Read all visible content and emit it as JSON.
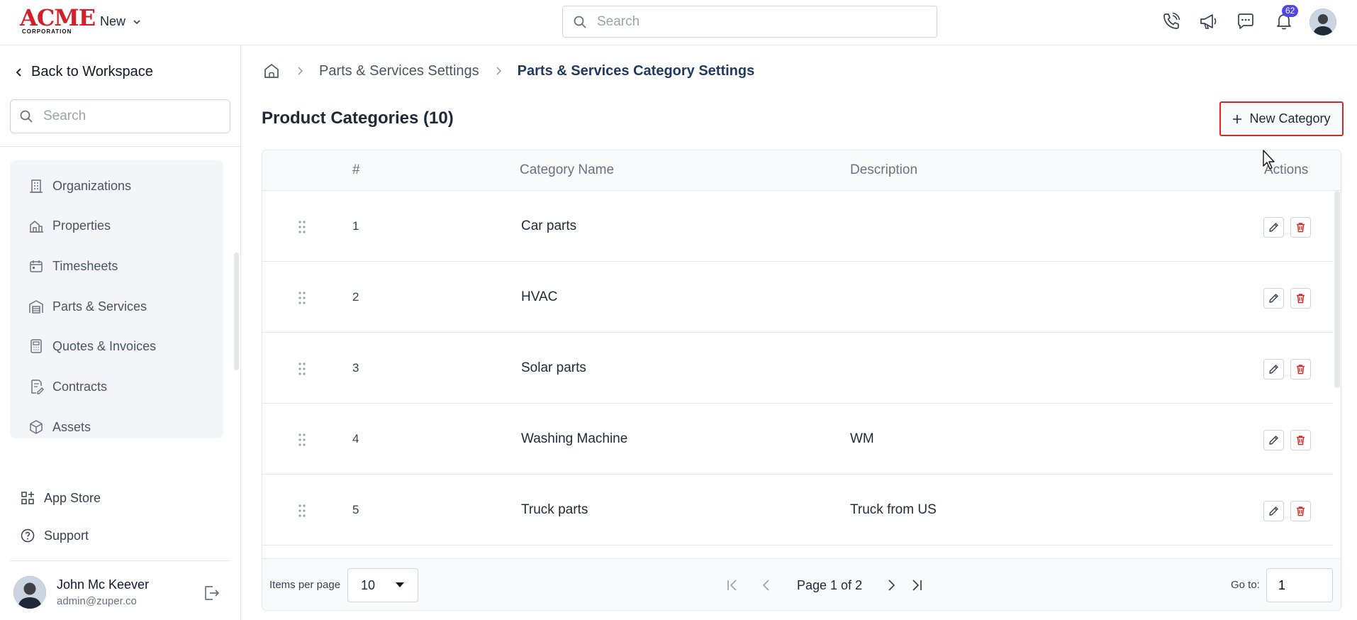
{
  "header": {
    "logo_main": "ACME",
    "logo_sub": "CORPORATION",
    "new_label": "New",
    "search_placeholder": "Search",
    "notification_count": "62"
  },
  "sidebar": {
    "back_label": "Back to Workspace",
    "search_placeholder": "Search",
    "items": [
      {
        "label": "Organizations",
        "icon": "building-icon"
      },
      {
        "label": "Properties",
        "icon": "properties-icon"
      },
      {
        "label": "Timesheets",
        "icon": "calendar-icon"
      },
      {
        "label": "Parts & Services",
        "icon": "warehouse-icon"
      },
      {
        "label": "Quotes & Invoices",
        "icon": "calculator-icon"
      },
      {
        "label": "Contracts",
        "icon": "contract-icon"
      },
      {
        "label": "Assets",
        "icon": "cube-icon"
      }
    ],
    "bottom_items": [
      {
        "label": "App Store",
        "icon": "app-store-icon"
      },
      {
        "label": "Support",
        "icon": "help-icon"
      }
    ],
    "user": {
      "name": "John Mc Keever",
      "email": "admin@zuper.co"
    }
  },
  "breadcrumb": {
    "items": [
      "Parts & Services Settings",
      "Parts & Services Category Settings"
    ]
  },
  "page": {
    "title": "Product Categories (10)",
    "new_button_label": "New Category"
  },
  "table": {
    "columns": [
      "#",
      "Category Name",
      "Description",
      "Actions"
    ],
    "rows": [
      {
        "num": "1",
        "name": "Car parts",
        "description": ""
      },
      {
        "num": "2",
        "name": "HVAC",
        "description": ""
      },
      {
        "num": "3",
        "name": "Solar parts",
        "description": ""
      },
      {
        "num": "4",
        "name": "Washing Machine",
        "description": "WM"
      },
      {
        "num": "5",
        "name": "Truck parts",
        "description": "Truck from US"
      }
    ]
  },
  "pagination": {
    "items_per_page_label": "Items per page",
    "items_per_page_value": "10",
    "page_text": "Page 1 of 2",
    "goto_label": "Go to:",
    "goto_value": "1"
  },
  "colors": {
    "accent_red": "#dc2626",
    "badge": "#4f46e5",
    "breadcrumb_current": "#1e3a5f"
  }
}
